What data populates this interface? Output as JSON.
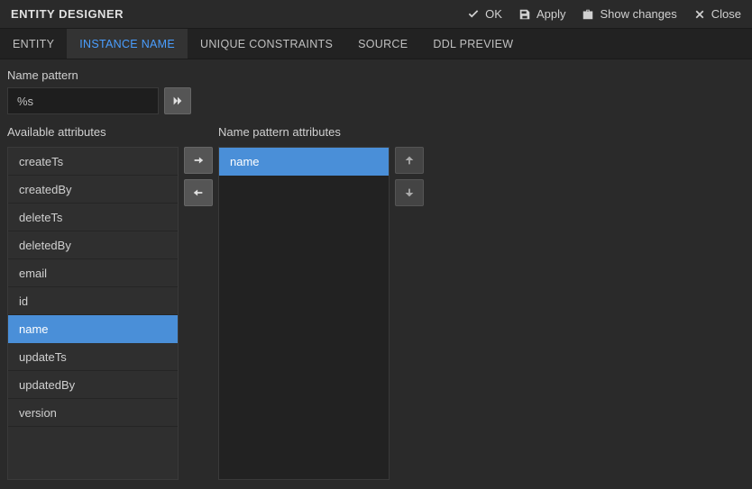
{
  "header": {
    "title": "ENTITY DESIGNER",
    "ok": "OK",
    "apply": "Apply",
    "show_changes": "Show changes",
    "close": "Close"
  },
  "tabs": {
    "entity": "ENTITY",
    "instance_name": "INSTANCE NAME",
    "unique_constraints": "UNIQUE CONSTRAINTS",
    "source": "SOURCE",
    "ddl_preview": "DDL PREVIEW",
    "active": "instance_name"
  },
  "name_pattern": {
    "label": "Name pattern",
    "value": "%s"
  },
  "available": {
    "label": "Available attributes",
    "items": [
      "createTs",
      "createdBy",
      "deleteTs",
      "deletedBy",
      "email",
      "id",
      "name",
      "updateTs",
      "updatedBy",
      "version"
    ],
    "selected": "name"
  },
  "pattern_attrs": {
    "label": "Name pattern attributes",
    "items": [
      "name"
    ],
    "selected": "name"
  }
}
